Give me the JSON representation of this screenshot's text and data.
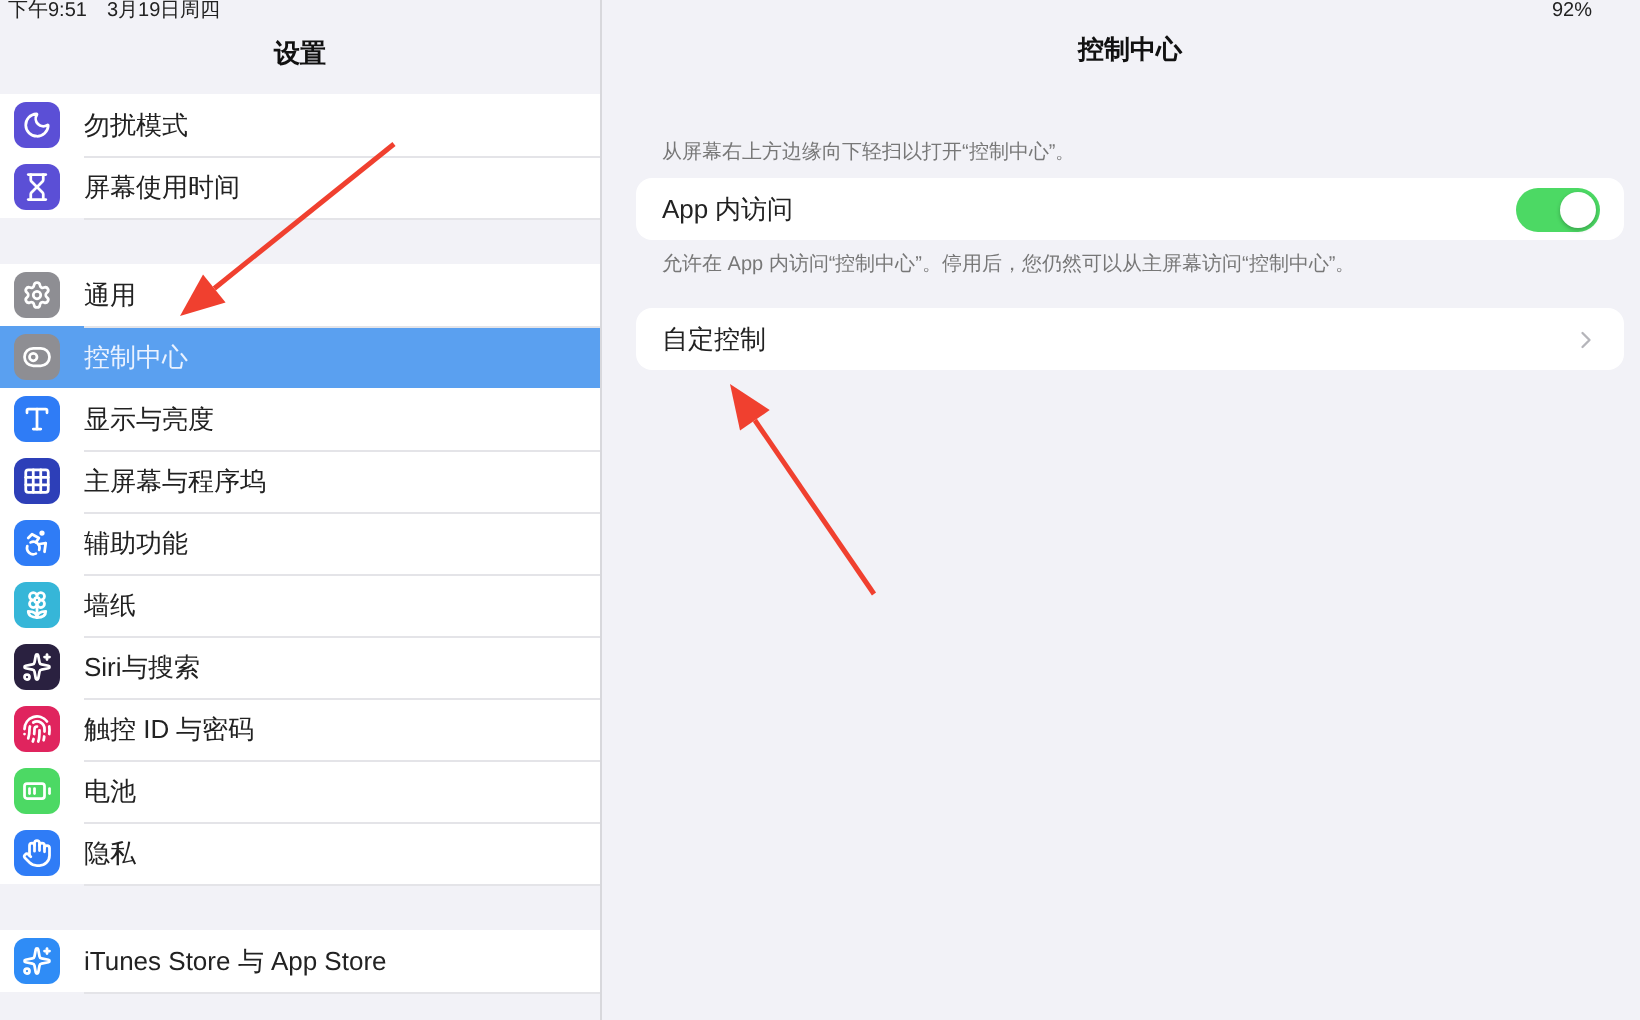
{
  "status_bar": {
    "time": "下午9:51",
    "date": "3月19日周四",
    "battery": "92%"
  },
  "sidebar": {
    "title": "设置",
    "groups": [
      {
        "items": [
          {
            "label": "勿扰模式",
            "kind": "moon",
            "color": "#5b4fd6",
            "selected": false
          },
          {
            "label": "屏幕使用时间",
            "kind": "hourglass",
            "color": "#5b4fd6",
            "selected": false
          }
        ]
      },
      {
        "items": [
          {
            "label": "通用",
            "kind": "gear",
            "color": "#8e8e93",
            "selected": false
          },
          {
            "label": "控制中心",
            "kind": "toggles",
            "color": "#8e8e93",
            "selected": true
          },
          {
            "label": "显示与亮度",
            "kind": "aa",
            "color": "#2f7cf6",
            "selected": false
          },
          {
            "label": "主屏幕与程序坞",
            "kind": "grid",
            "color": "#2d3fb8",
            "selected": false
          },
          {
            "label": "辅助功能",
            "kind": "person",
            "color": "#2f7cf6",
            "selected": false
          },
          {
            "label": "墙纸",
            "kind": "flower",
            "color": "#36b6d8",
            "selected": false
          },
          {
            "label": "Siri与搜索",
            "kind": "siri",
            "color": "#2a2140",
            "selected": false
          },
          {
            "label": "触控 ID 与密码",
            "kind": "fingerprint",
            "color": "#e0245e",
            "selected": false
          },
          {
            "label": "电池",
            "kind": "battery",
            "color": "#4cd964",
            "selected": false
          },
          {
            "label": "隐私",
            "kind": "hand",
            "color": "#2f7cf6",
            "selected": false
          }
        ]
      },
      {
        "items": [
          {
            "label": "iTunes Store 与 App Store",
            "kind": "appstore",
            "color": "#2f8cf6",
            "selected": false
          }
        ]
      }
    ]
  },
  "detail": {
    "title": "控制中心",
    "caption": "从屏幕右上方边缘向下轻扫以打开“控制中心”。",
    "access": {
      "label": "App 内访问",
      "on": true
    },
    "access_note": "允许在 App 内访问“控制中心”。停用后，您仍然可以从主屏幕访问“控制中心”。",
    "customize": {
      "label": "自定控制"
    }
  }
}
